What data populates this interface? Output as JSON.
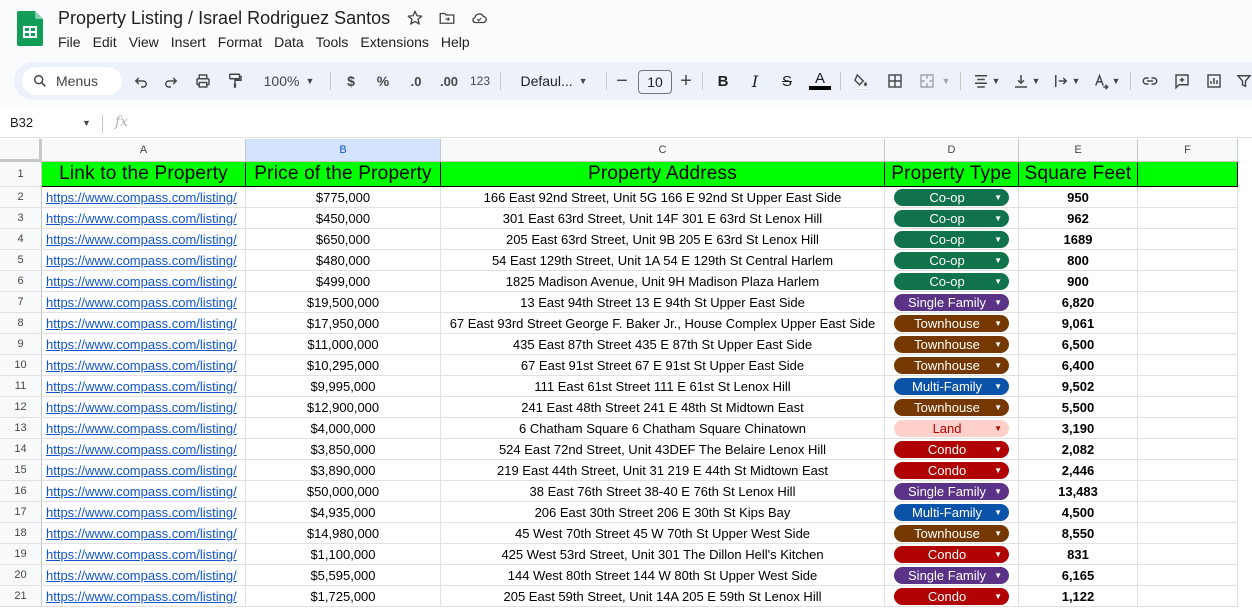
{
  "doc": {
    "title": "Property Listing / Israel Rodriguez Santos",
    "menu": [
      "File",
      "Edit",
      "View",
      "Insert",
      "Format",
      "Data",
      "Tools",
      "Extensions",
      "Help"
    ]
  },
  "toolbar": {
    "menus_label": "Menus",
    "zoom": "100%",
    "currency": "$",
    "percent": "%",
    "decrease_decimal": ".0",
    "increase_decimal": ".00",
    "number_format": "123",
    "font": "Defaul...",
    "font_size": "10",
    "bold": "B",
    "italic": "I",
    "strike": "S",
    "text_color": "A"
  },
  "formula_bar": {
    "name_box": "B32",
    "fx": "fx"
  },
  "columns": [
    "A",
    "B",
    "C",
    "D",
    "E",
    "F"
  ],
  "selected_column": "B",
  "header_row": [
    "Link to the Property",
    "Price of the Property",
    "Property Address",
    "Property Type",
    "Square Feet",
    ""
  ],
  "chip_colors": {
    "Co-op": {
      "bg": "#11734b",
      "fg": "#ffffff"
    },
    "Single Family": {
      "bg": "#5a3286",
      "fg": "#ffffff"
    },
    "Townhouse": {
      "bg": "#753800",
      "fg": "#ffffff"
    },
    "Multi-Family": {
      "bg": "#0a53a8",
      "fg": "#ffffff"
    },
    "Land": {
      "bg": "#ffcfc9",
      "fg": "#b10202"
    },
    "Condo": {
      "bg": "#b10202",
      "fg": "#ffffff"
    }
  },
  "rows": [
    {
      "n": "2",
      "link": "https://www.compass.com/listing/",
      "price": "$775,000",
      "address": "166 East 92nd Street, Unit 5G 166 E 92nd St Upper East Side",
      "type": "Co-op",
      "sqft": "950"
    },
    {
      "n": "3",
      "link": "https://www.compass.com/listing/",
      "price": "$450,000",
      "address": "301 East 63rd Street, Unit 14F 301 E 63rd St Lenox Hill",
      "type": "Co-op",
      "sqft": "962"
    },
    {
      "n": "4",
      "link": "https://www.compass.com/listing/",
      "price": "$650,000",
      "address": "205 East 63rd Street, Unit 9B 205 E 63rd St Lenox Hill",
      "type": "Co-op",
      "sqft": "1689"
    },
    {
      "n": "5",
      "link": "https://www.compass.com/listing/",
      "price": "$480,000",
      "address": "54 East 129th Street, Unit 1A 54 E 129th St Central Harlem",
      "type": "Co-op",
      "sqft": "800"
    },
    {
      "n": "6",
      "link": "https://www.compass.com/listing/",
      "price": "$499,000",
      "address": "1825 Madison Avenue, Unit 9H Madison Plaza Harlem",
      "type": "Co-op",
      "sqft": "900"
    },
    {
      "n": "7",
      "link": "https://www.compass.com/listing/",
      "price": "$19,500,000",
      "address": "13 East 94th Street 13 E 94th St Upper East Side",
      "type": "Single Family",
      "sqft": "6,820"
    },
    {
      "n": "8",
      "link": "https://www.compass.com/listing/",
      "price": "$17,950,000",
      "address": "67 East 93rd Street George F. Baker Jr., House Complex Upper East Side",
      "type": "Townhouse",
      "sqft": "9,061"
    },
    {
      "n": "9",
      "link": "https://www.compass.com/listing/",
      "price": "$11,000,000",
      "address": "435 East 87th Street 435 E 87th St Upper East Side",
      "type": "Townhouse",
      "sqft": "6,500"
    },
    {
      "n": "10",
      "link": "https://www.compass.com/listing/",
      "price": "$10,295,000",
      "address": "67 East 91st Street 67 E 91st St Upper East Side",
      "type": "Townhouse",
      "sqft": "6,400"
    },
    {
      "n": "11",
      "link": "https://www.compass.com/listing/",
      "price": "$9,995,000",
      "address": "111 East 61st Street 111 E 61st St Lenox Hill",
      "type": "Multi-Family",
      "sqft": "9,502"
    },
    {
      "n": "12",
      "link": "https://www.compass.com/listing/",
      "price": "$12,900,000",
      "address": "241 East 48th Street 241 E 48th St Midtown East",
      "type": "Townhouse",
      "sqft": "5,500"
    },
    {
      "n": "13",
      "link": "https://www.compass.com/listing/",
      "price": "$4,000,000",
      "address": "6 Chatham Square 6 Chatham Square Chinatown",
      "type": "Land",
      "sqft": "3,190"
    },
    {
      "n": "14",
      "link": "https://www.compass.com/listing/",
      "price": "$3,850,000",
      "address": "524 East 72nd Street, Unit 43DEF The Belaire Lenox Hill",
      "type": "Condo",
      "sqft": "2,082"
    },
    {
      "n": "15",
      "link": "https://www.compass.com/listing/",
      "price": "$3,890,000",
      "address": "219 East 44th Street, Unit 31 219 E 44th St Midtown East",
      "type": "Condo",
      "sqft": "2,446"
    },
    {
      "n": "16",
      "link": "https://www.compass.com/listing/",
      "price": "$50,000,000",
      "address": "38 East 76th Street 38-40 E 76th St Lenox Hill",
      "type": "Single Family",
      "sqft": "13,483"
    },
    {
      "n": "17",
      "link": "https://www.compass.com/listing/",
      "price": "$4,935,000",
      "address": "206 East 30th Street 206 E 30th St Kips Bay",
      "type": "Multi-Family",
      "sqft": "4,500"
    },
    {
      "n": "18",
      "link": "https://www.compass.com/listing/",
      "price": "$14,980,000",
      "address": "45 West 70th Street 45 W 70th St Upper West Side",
      "type": "Townhouse",
      "sqft": "8,550"
    },
    {
      "n": "19",
      "link": "https://www.compass.com/listing/",
      "price": "$1,100,000",
      "address": "425 West 53rd Street, Unit 301 The Dillon Hell's Kitchen",
      "type": "Condo",
      "sqft": "831"
    },
    {
      "n": "20",
      "link": "https://www.compass.com/listing/",
      "price": "$5,595,000",
      "address": "144 West 80th Street 144 W 80th St Upper West Side",
      "type": "Single Family",
      "sqft": "6,165"
    },
    {
      "n": "21",
      "link": "https://www.compass.com/listing/",
      "price": "$1,725,000",
      "address": "205 East 59th Street, Unit 14A 205 E 59th St Lenox Hill",
      "type": "Condo",
      "sqft": "1,122"
    }
  ]
}
